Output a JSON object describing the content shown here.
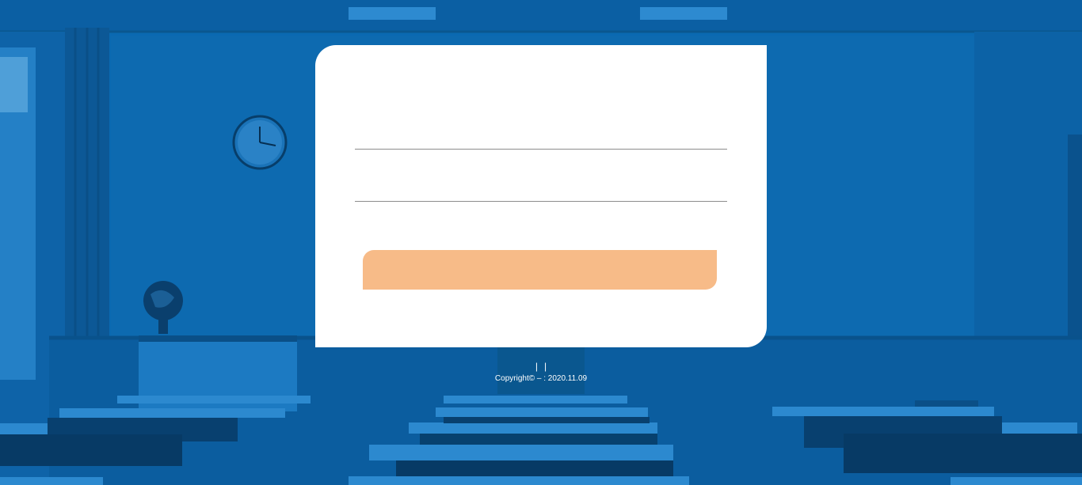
{
  "login": {
    "username_value": "",
    "password_value": "",
    "button_label": ""
  },
  "footer": {
    "separator_1": "|",
    "separator_2": "|",
    "copyright": "Copyright© – : 2020.11.09"
  },
  "colors": {
    "background": "#0a69b1",
    "card": "#ffffff",
    "button": "#f7bb88"
  }
}
